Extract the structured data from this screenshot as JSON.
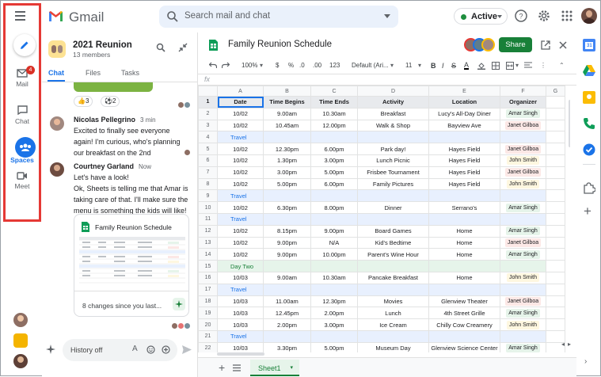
{
  "topbar": {
    "app_name": "Gmail",
    "search_placeholder": "Search mail and chat",
    "status": "Active"
  },
  "rail": {
    "mail_label": "Mail",
    "mail_badge": "4",
    "chat_label": "Chat",
    "spaces_label": "Spaces",
    "meet_label": "Meet"
  },
  "chat": {
    "title": "2021 Reunion",
    "members": "13 members",
    "tabs": [
      "Chat",
      "Files",
      "Tasks"
    ],
    "reactions": [
      "👍3",
      "⚽2"
    ],
    "messages": [
      {
        "name": "Nicolas Pellegrino",
        "time": "3 min",
        "lines": [
          "Excited to finally see everyone",
          "again! I'm curious, who's planning",
          "our breakfast on the 2nd"
        ]
      },
      {
        "name": "Courtney Garland",
        "time": "Now",
        "lines": [
          "Let's have a look!",
          "",
          "Ok, Sheets is telling me that Amar is",
          "taking care of that. I'll make sure the",
          "menu is something the kids will like!"
        ]
      }
    ],
    "card_title": "Family Reunion Schedule",
    "card_footer": "8 changes since you last...",
    "input_placeholder": "History off"
  },
  "sheet": {
    "title": "Family Reunion Schedule",
    "share_label": "Share",
    "toolbar": {
      "zoom": "100%",
      "currency": "$",
      "percent": "%",
      "dec0": ".0",
      "dec00": ".00",
      "format": "123",
      "font": "Default (Ari...",
      "size": "11"
    },
    "fx": "fx",
    "columns": [
      "A",
      "B",
      "C",
      "D",
      "E",
      "F",
      "G"
    ],
    "header": [
      "Date",
      "Time Begins",
      "Time Ends",
      "Activity",
      "Location",
      "Organizer"
    ],
    "rows": [
      {
        "n": "2",
        "cells": [
          "10/02",
          "9.00am",
          "10.30am",
          "Breakfast",
          "Lucy's All-Day Diner"
        ],
        "org": "Amar Singh",
        "oc": "#e6f4ea"
      },
      {
        "n": "3",
        "cells": [
          "10/02",
          "10.45am",
          "12.00pm",
          "Walk & Shop",
          "Bayview Ave"
        ],
        "org": "Janet Gilboa",
        "oc": "#fce8e6"
      },
      {
        "n": "4",
        "section": "Travel"
      },
      {
        "n": "5",
        "cells": [
          "10/02",
          "12.30pm",
          "6.00pm",
          "Park day!",
          "Hayes Field"
        ],
        "org": "Janet Gilboa",
        "oc": "#fce8e6"
      },
      {
        "n": "6",
        "cells": [
          "10/02",
          "1.30pm",
          "3.00pm",
          "Lunch Picnic",
          "Hayes Field"
        ],
        "org": "John Smith",
        "oc": "#fef7e0"
      },
      {
        "n": "7",
        "cells": [
          "10/02",
          "3.00pm",
          "5.00pm",
          "Frisbee Tournament",
          "Hayes Field"
        ],
        "org": "Janet Gilboa",
        "oc": "#fce8e6"
      },
      {
        "n": "8",
        "cells": [
          "10/02",
          "5.00pm",
          "6.00pm",
          "Family Pictures",
          "Hayes Field"
        ],
        "org": "John Smith",
        "oc": "#fef7e0"
      },
      {
        "n": "9",
        "section": "Travel"
      },
      {
        "n": "10",
        "cells": [
          "10/02",
          "6.30pm",
          "8.00pm",
          "Dinner",
          "Serrano's"
        ],
        "org": "Amar Singh",
        "oc": "#e6f4ea"
      },
      {
        "n": "11",
        "section": "Travel"
      },
      {
        "n": "12",
        "cells": [
          "10/02",
          "8.15pm",
          "9.00pm",
          "Board Games",
          "Home"
        ],
        "org": "Amar Singh",
        "oc": "#e6f4ea"
      },
      {
        "n": "13",
        "cells": [
          "10/02",
          "9.00pm",
          "N/A",
          "Kid's Bedtime",
          "Home"
        ],
        "org": "Janet Gilboa",
        "oc": "#fce8e6"
      },
      {
        "n": "14",
        "cells": [
          "10/02",
          "9.00pm",
          "10.00pm",
          "Parent's Wine Hour",
          "Home"
        ],
        "org": "Amar Singh",
        "oc": "#e6f4ea"
      },
      {
        "n": "15",
        "section": "Day Two",
        "green": true
      },
      {
        "n": "16",
        "cells": [
          "10/03",
          "9.00am",
          "10.30am",
          "Pancake Breakfast",
          "Home"
        ],
        "org": "John Smith",
        "oc": "#fef7e0"
      },
      {
        "n": "17",
        "section": "Travel"
      },
      {
        "n": "18",
        "cells": [
          "10/03",
          "11.00am",
          "12.30pm",
          "Movies",
          "Glenview Theater"
        ],
        "org": "Janet Gilboa",
        "oc": "#fce8e6"
      },
      {
        "n": "19",
        "cells": [
          "10/03",
          "12.45pm",
          "2.00pm",
          "Lunch",
          "4th Street Grille"
        ],
        "org": "Amar Singh",
        "oc": "#e6f4ea"
      },
      {
        "n": "20",
        "cells": [
          "10/03",
          "2.00pm",
          "3.00pm",
          "Ice Cream",
          "Chilly Cow Creamery"
        ],
        "org": "John Smith",
        "oc": "#fef7e0"
      },
      {
        "n": "21",
        "section": "Travel"
      },
      {
        "n": "22",
        "cells": [
          "10/03",
          "3.30pm",
          "5.00pm",
          "Museum Day",
          "Glenview Science Center"
        ],
        "org": "Amar Singh",
        "oc": "#e6f4ea"
      }
    ],
    "header_row_num": "1",
    "sheet_tab": "Sheet1"
  }
}
